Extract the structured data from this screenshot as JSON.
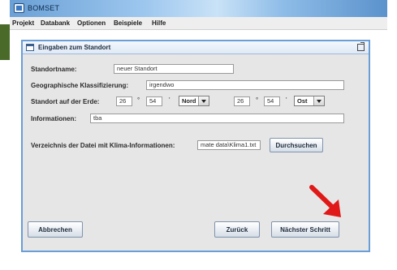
{
  "window": {
    "title": "BOMSET"
  },
  "menu": [
    "Projekt",
    "Databank",
    "Optionen",
    "Beispiele",
    "Hilfe"
  ],
  "frame": {
    "title": "Eingaben zum Standort"
  },
  "form": {
    "standortname": {
      "label": "Standortname:",
      "value": "neuer Standort"
    },
    "klassifizierung": {
      "label": "Geographische Klassifizierung:",
      "value": "irgendwo"
    },
    "erde": {
      "label": "Standort auf der Erde:",
      "lat_deg": "26",
      "lat_min": "54",
      "lat_dir": "Nord",
      "lon_deg": "26",
      "lon_min": "54",
      "lon_dir": "Ost",
      "deg_symbol": "°",
      "min_symbol": "'"
    },
    "informationen": {
      "label": "Informationen:",
      "value": "tba"
    },
    "klima": {
      "label": "Verzeichnis der Datei mit Klima-Informationen:",
      "value": "mate data\\Klima1.txt"
    }
  },
  "buttons": {
    "browse": "Durchsuchen",
    "cancel": "Abbrechen",
    "back": "Zurück",
    "next": "Nächster Schritt"
  },
  "colors": {
    "arrow": "#e01818",
    "frame_border": "#6a9ed6"
  }
}
